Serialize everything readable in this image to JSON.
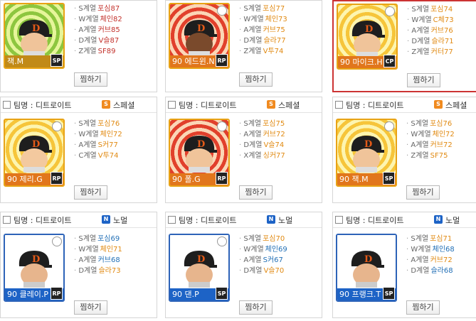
{
  "cells": [
    {
      "team": "",
      "category": "",
      "cat_icon": "",
      "name": "잭.M",
      "pos": "SP",
      "stats": [
        {
          "k": "S계열",
          "v": "포심87",
          "c": "red"
        },
        {
          "k": "W계열",
          "v": "체인82",
          "c": "red"
        },
        {
          "k": "A계열",
          "v": "커브85",
          "c": "red"
        },
        {
          "k": "D계열",
          "v": "V슬87",
          "c": "red"
        },
        {
          "k": "Z계열",
          "v": "SF89",
          "c": "red"
        }
      ],
      "button": "찜하기"
    },
    {
      "team": "",
      "category": "",
      "cat_icon": "",
      "name": "90 에드윈.N",
      "pos": "RP",
      "stats": [
        {
          "k": "S계열",
          "v": "포심77",
          "c": "orange"
        },
        {
          "k": "W계열",
          "v": "체인73",
          "c": "orange"
        },
        {
          "k": "A계열",
          "v": "커브75",
          "c": "orange"
        },
        {
          "k": "D계열",
          "v": "슬라77",
          "c": "orange"
        },
        {
          "k": "Z계열",
          "v": "V투74",
          "c": "orange"
        }
      ],
      "button": "찜하기"
    },
    {
      "team": "",
      "category": "",
      "cat_icon": "",
      "name": "90 마이크.H",
      "pos": "CP",
      "stats": [
        {
          "k": "S계열",
          "v": "포심74",
          "c": "orange"
        },
        {
          "k": "W계열",
          "v": "C체73",
          "c": "orange"
        },
        {
          "k": "A계열",
          "v": "커브76",
          "c": "orange"
        },
        {
          "k": "D계열",
          "v": "슬라71",
          "c": "orange"
        },
        {
          "k": "Z계열",
          "v": "커터77",
          "c": "orange"
        }
      ],
      "button": "찜하기"
    },
    {
      "team": "팀명 : 디트로이트",
      "category": "스페셜",
      "cat_icon": "S",
      "name": "90 제리.G",
      "pos": "RP",
      "stats": [
        {
          "k": "S계열",
          "v": "포심76",
          "c": "orange"
        },
        {
          "k": "W계열",
          "v": "체인72",
          "c": "orange"
        },
        {
          "k": "A계열",
          "v": "S커77",
          "c": "orange"
        },
        {
          "k": "C계열",
          "v": "V투74",
          "c": "orange"
        }
      ],
      "button": "찜하기"
    },
    {
      "team": "팀명 : 디트로이트",
      "category": "스페셜",
      "cat_icon": "S",
      "name": "90 폴.G",
      "pos": "RP",
      "stats": [
        {
          "k": "S계열",
          "v": "포심75",
          "c": "orange"
        },
        {
          "k": "A계열",
          "v": "커브72",
          "c": "orange"
        },
        {
          "k": "D계열",
          "v": "V슬74",
          "c": "orange"
        },
        {
          "k": "X계열",
          "v": "싱커77",
          "c": "orange"
        }
      ],
      "button": "찜하기"
    },
    {
      "team": "팀명 : 디트로이트",
      "category": "스페셜",
      "cat_icon": "S",
      "name": "90 잭.M",
      "pos": "SP",
      "stats": [
        {
          "k": "S계열",
          "v": "포심76",
          "c": "orange"
        },
        {
          "k": "W계열",
          "v": "체인72",
          "c": "orange"
        },
        {
          "k": "A계열",
          "v": "커브72",
          "c": "orange"
        },
        {
          "k": "Z계열",
          "v": "SF75",
          "c": "orange"
        }
      ],
      "button": "찜하기"
    },
    {
      "team": "팀명 : 디트로이트",
      "category": "노멀",
      "cat_icon": "N",
      "name": "90 클레이.P",
      "pos": "RP",
      "stats": [
        {
          "k": "S계열",
          "v": "포심69",
          "c": "blue"
        },
        {
          "k": "W계열",
          "v": "체인71",
          "c": "orange"
        },
        {
          "k": "A계열",
          "v": "커브68",
          "c": "blue"
        },
        {
          "k": "D계열",
          "v": "슬라73",
          "c": "orange"
        }
      ],
      "button": "찜하기"
    },
    {
      "team": "팀명 : 디트로이트",
      "category": "노멀",
      "cat_icon": "N",
      "name": "90 댄.P",
      "pos": "SP",
      "stats": [
        {
          "k": "S계열",
          "v": "포심70",
          "c": "orange"
        },
        {
          "k": "W계열",
          "v": "체인69",
          "c": "blue"
        },
        {
          "k": "A계열",
          "v": "S커67",
          "c": "blue"
        },
        {
          "k": "D계열",
          "v": "V슬70",
          "c": "orange"
        }
      ],
      "button": "찜하기"
    },
    {
      "team": "팀명 : 디트로이트",
      "category": "노멀",
      "cat_icon": "N",
      "name": "90 프랭크.T",
      "pos": "SP",
      "stats": [
        {
          "k": "S계열",
          "v": "포심71",
          "c": "orange"
        },
        {
          "k": "W계열",
          "v": "체인68",
          "c": "blue"
        },
        {
          "k": "A계열",
          "v": "커브72",
          "c": "orange"
        },
        {
          "k": "D계열",
          "v": "슬라68",
          "c": "blue"
        }
      ],
      "button": "찜하기"
    }
  ]
}
